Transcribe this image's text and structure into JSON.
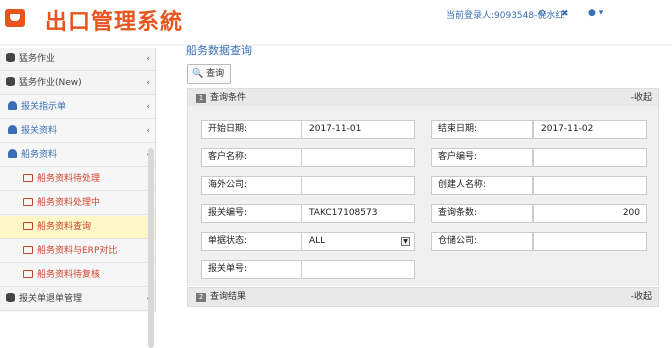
{
  "header": {
    "title": "出口管理系統",
    "login_text": "当前登录人:9093548-倪水红",
    "tool_icon_1": "⚙",
    "tool_icon_2": "✖",
    "user_menu": "▾"
  },
  "sidebar": {
    "items": [
      {
        "label": "猛务作业",
        "chev": "‹"
      },
      {
        "label": "猛务作业(New)",
        "chev": "‹"
      },
      {
        "label": "报关指示单",
        "chev": "‹"
      },
      {
        "label": "报关资料",
        "chev": "‹"
      },
      {
        "label": "船务资料",
        "chev": "‹"
      },
      {
        "label": "船务资料待处理"
      },
      {
        "label": "船务资料处理中"
      },
      {
        "label": "船务资料查询"
      },
      {
        "label": "船务资料与ERP对比"
      },
      {
        "label": "船务资料待复核"
      },
      {
        "label": "报关单退单管理",
        "chev": "‹"
      }
    ]
  },
  "main": {
    "page_title": "船务数据查询",
    "query_button": "查询",
    "panel1": {
      "num": "1",
      "title": "查询条件",
      "collapse": "-收起"
    },
    "panel2": {
      "num": "2",
      "title": "查询结果",
      "collapse": "-收起"
    },
    "fields": {
      "start_date": {
        "label": "开始日期:",
        "value": "2017-11-01"
      },
      "end_date": {
        "label": "结束日期:",
        "value": "2017-11-02"
      },
      "customer_name": {
        "label": "客户名称:",
        "value": ""
      },
      "customer_no": {
        "label": "客户编号:",
        "value": ""
      },
      "overseas_company": {
        "label": "海外公司:",
        "value": ""
      },
      "creator_name": {
        "label": "创建人名称:",
        "value": ""
      },
      "customs_no": {
        "label": "报关编号:",
        "value": "TAKC17108573"
      },
      "query_count": {
        "label": "查询条数:",
        "value": "200"
      },
      "doc_status": {
        "label": "单据状态:",
        "value": "ALL"
      },
      "warehouse_company": {
        "label": "仓储公司:",
        "value": ""
      },
      "customs_doc_no": {
        "label": "报关单号:",
        "value": ""
      }
    }
  },
  "colors": {
    "brand": "#e8541e",
    "link": "#3a6fb6",
    "menu_red": "#d2432d",
    "active_bg": "#fff7c8"
  }
}
